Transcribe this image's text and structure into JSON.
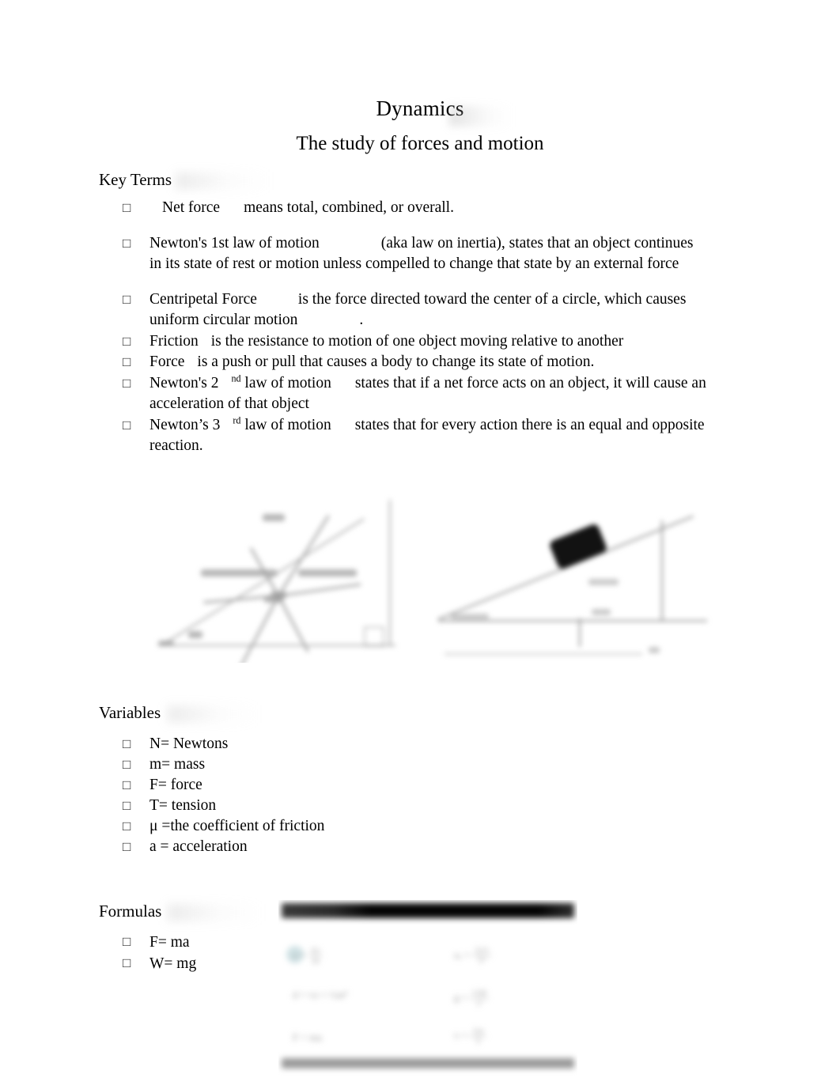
{
  "document": {
    "title": "Dynamics",
    "subtitle": "The study of forces and motion"
  },
  "sections": {
    "key_terms": {
      "heading": "Key Terms",
      "items": [
        {
          "term": "Net force",
          "definition": "means total, combined, or overall."
        },
        {
          "term": "Newton's 1st law of motion",
          "definition": "(aka law on inertia), states that an object continues in its state of rest or motion unless compelled to change that state by an external force"
        },
        {
          "term": "Centripetal Force",
          "definition": "is the force directed toward the center of a circle, which causes uniform circular motion"
        },
        {
          "term": "Friction",
          "definition": "is the   resistance to motion of one object moving relative to another"
        },
        {
          "term": "Force",
          "definition": "is a push or pull that causes a body to change its state of motion."
        },
        {
          "term": "Newton's 2nd law of motion",
          "term_base": "Newton's 2",
          "term_sup": "nd",
          "term_rest": "law of motion",
          "definition": "states that if a net force acts on an object, it will cause an acceleration of that object"
        },
        {
          "term": "Newton’s 3rd law of motion",
          "term_base": "Newton’s 3",
          "term_sup": "rd",
          "term_rest": "law of motion",
          "definition": "states that for every action there is an equal and opposite reaction."
        }
      ],
      "trailing_period": "."
    },
    "variables": {
      "heading": "Variables",
      "items": [
        "N=  Newtons",
        "m=   mass",
        "F= force",
        "T= tension",
        "μ =the coefficient of friction",
        "a =  acceleration"
      ]
    },
    "formulas": {
      "heading": "Formulas",
      "items": [
        "F= ma",
        "W= mg"
      ]
    }
  },
  "figures": {
    "incline_forces": {
      "name": "inclined-plane free-body diagram",
      "state": "blurred"
    },
    "block_on_incline": {
      "name": "block on inclined plane diagram",
      "state": "blurred"
    },
    "formula_card": {
      "name": "formula reference card",
      "state": "blurred",
      "equations": [
        {
          "lhs": "a =",
          "num": "Δv",
          "den": "Δt"
        },
        {
          "lhs": "aₐ =",
          "num": "2π²r",
          "den": "T²"
        },
        {
          "lhs": "d =",
          "rhs": "vᵢt + ½at²"
        },
        {
          "lhs": "g =",
          "num": "GM",
          "den": "r²"
        },
        {
          "lhs": "F =",
          "rhs": "ma"
        },
        {
          "lhs": "v =",
          "num": "2πr",
          "den": "T"
        }
      ]
    }
  },
  "bullet_glyph": "□",
  "colors": {
    "text": "#000000",
    "bullet": "#2b2b2b",
    "figure_line": "#a9a9a9",
    "card_topbar": "#050505",
    "card_botbar": "#9a9a9a",
    "card_accent": "#c8dde1"
  }
}
